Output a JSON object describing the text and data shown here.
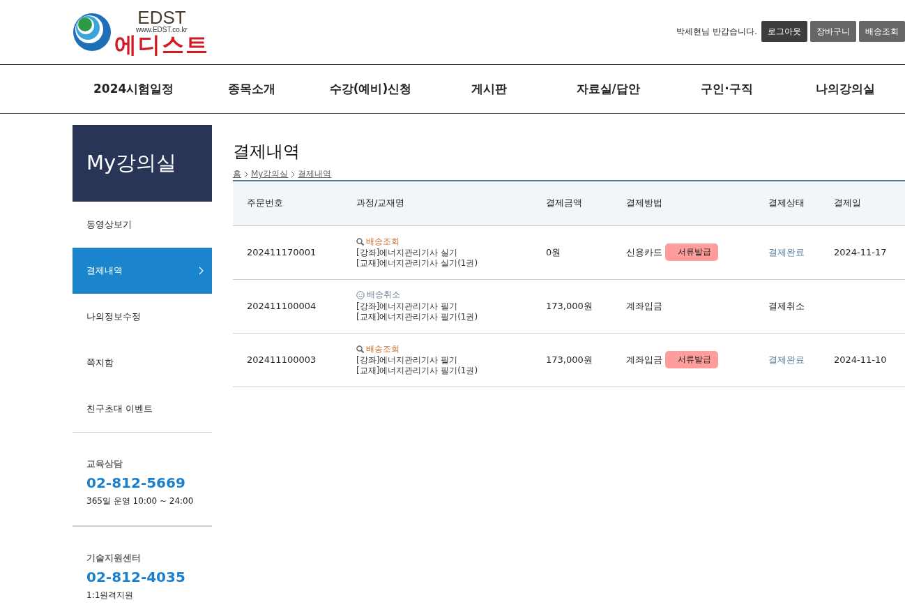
{
  "logo": {
    "brand": "EDST",
    "url": "www.EDST.co.kr",
    "name": "에디스트"
  },
  "user_bar": {
    "greeting": "박세현님 반갑습니다.",
    "buttons": [
      {
        "label": "로그아웃",
        "kind": "dark"
      },
      {
        "label": "장바구니",
        "kind": "gray"
      },
      {
        "label": "배송조회",
        "kind": "gray"
      }
    ]
  },
  "nav": [
    "2024시험일정",
    "종목소개",
    "수강(예비)신청",
    "게시판",
    "자료실/답안",
    "구인·구직",
    "나의강의실"
  ],
  "sidebar": {
    "title": "My강의실",
    "items": [
      {
        "label": "동영상보기",
        "selected": false
      },
      {
        "label": "결제내역",
        "selected": true
      },
      {
        "label": "나의정보수정",
        "selected": false
      },
      {
        "label": "쪽지함",
        "selected": false
      },
      {
        "label": "친구초대 이벤트",
        "selected": false
      }
    ]
  },
  "contacts": [
    {
      "title": "교육상담",
      "phone": "02-812-5669",
      "note": "365일 운영 10:00 ~ 24:00"
    },
    {
      "title": "기술지원센터",
      "phone": "02-812-4035",
      "note": "1:1원격지원"
    }
  ],
  "page_title": "결제내역",
  "breadcrumb": [
    "홈",
    "My강의실",
    "결제내역"
  ],
  "table": {
    "columns": [
      "주문번호",
      "과정/교재명",
      "결제금액",
      "결제방법",
      "결제상태",
      "결제일"
    ],
    "rows": [
      {
        "order": "202411170001",
        "delivery": {
          "kind": "track",
          "label": "배송조회"
        },
        "items": [
          "[강좌]에너지관리기사 실기",
          "[교재]에너지관리기사 실기(1권)"
        ],
        "amount": "0원",
        "method": "신용카드",
        "receipt": "서류발급",
        "status": {
          "kind": "complete",
          "label": "결제완료"
        },
        "date": "2024-11-17"
      },
      {
        "order": "202411100004",
        "delivery": {
          "kind": "cancel",
          "label": "배송취소"
        },
        "items": [
          "[강좌]에너지관리기사 필기",
          "[교재]에너지관리기사 필기(1권)"
        ],
        "amount": "173,000원",
        "method": "계좌입금",
        "status": {
          "kind": "cancelled",
          "label": "결제취소"
        }
      },
      {
        "order": "202411100003",
        "delivery": {
          "kind": "track",
          "label": "배송조회"
        },
        "items": [
          "[강좌]에너지관리기사 필기",
          "[교재]에너지관리기사 필기(1권)"
        ],
        "amount": "173,000원",
        "method": "계좌입금",
        "receipt": "서류발급",
        "status": {
          "kind": "complete",
          "label": "결제완료"
        },
        "date": "2024-11-10"
      }
    ]
  }
}
